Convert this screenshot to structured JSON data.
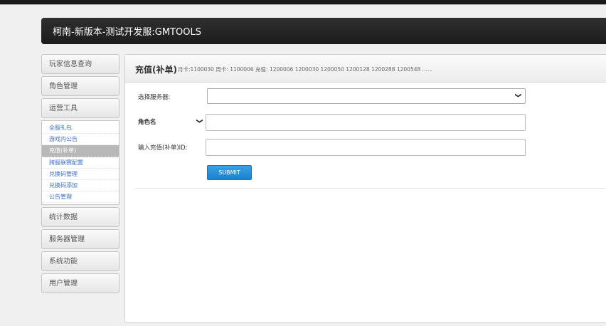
{
  "header": {
    "title": "柯南-新版本-测试开发服:GMTOOLS"
  },
  "sidebar": {
    "sections": [
      {
        "label": "玩家信息查询"
      },
      {
        "label": "角色管理"
      },
      {
        "label": "运营工具"
      }
    ],
    "submenu": [
      {
        "label": "全服礼包",
        "active": false
      },
      {
        "label": "游戏内公告",
        "active": false
      },
      {
        "label": "充值(补单)",
        "active": true
      },
      {
        "label": "跨服联赛配置",
        "active": false
      },
      {
        "label": "兑换码管理",
        "active": false
      },
      {
        "label": "兑换码添加",
        "active": false
      },
      {
        "label": "公告管理",
        "active": false
      }
    ],
    "sections_after": [
      {
        "label": "统计数据"
      },
      {
        "label": "服务器管理"
      },
      {
        "label": "系统功能"
      },
      {
        "label": "用户管理"
      }
    ]
  },
  "panel": {
    "title": "充值(补单)",
    "info": "月卡:1100030 周卡: 1100006 充值: 1200006 1200030 1200050 1200128 1200288 1200548 ......"
  },
  "form": {
    "server_label": "选择服务器:",
    "server_value": "",
    "role_select": "角色名",
    "role_value": "",
    "recharge_label": "输入充值(补单)ID:",
    "recharge_value": "",
    "submit_label": "SUBMIT"
  },
  "colors": {
    "header_bg": "#1c1c1c",
    "link": "#3a6fc4",
    "submit": "#1a82cf"
  },
  "icons": {
    "dropdown": "chevron-down-icon"
  }
}
